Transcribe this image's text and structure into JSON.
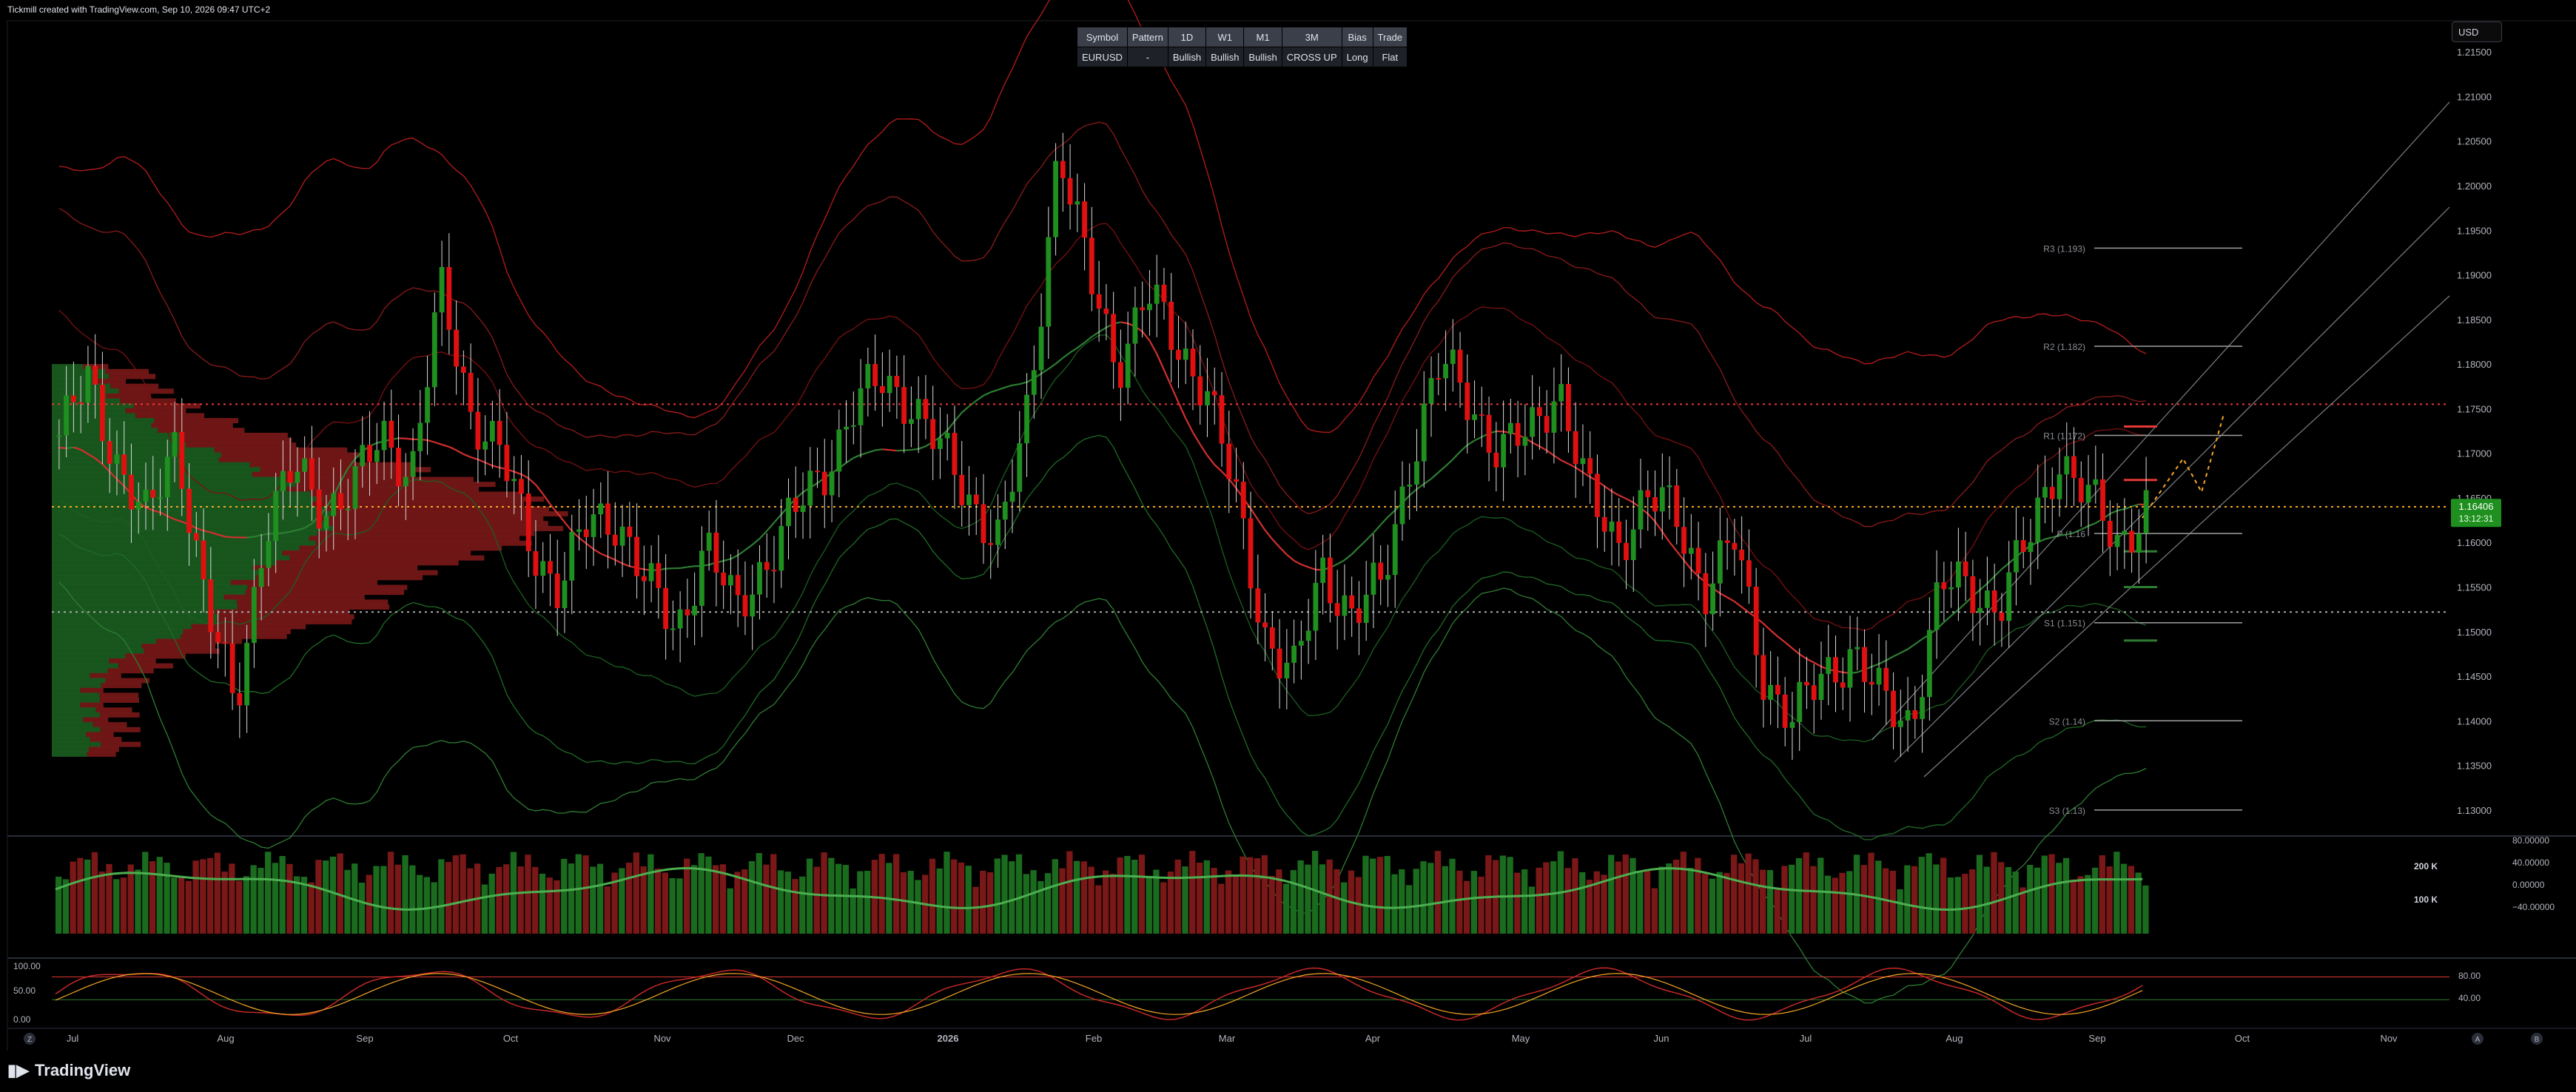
{
  "header": {
    "watermark": "Tickmill created with TradingView.com, Sep 10, 2026 09:47 UTC+2"
  },
  "currency_selector": "USD",
  "signal_table": {
    "headers": [
      "Symbol",
      "Pattern",
      "1D",
      "W1",
      "M1",
      "3M",
      "Bias",
      "Trade"
    ],
    "values": [
      "EURUSD",
      "-",
      "Bullish",
      "Bullish",
      "Bullish",
      "CROSS UP",
      "Long",
      "Flat"
    ]
  },
  "brand": {
    "logo_icon": "tradingview-logo-icon",
    "name": "TradingView"
  },
  "colors": {
    "bull": "#1f8f1f",
    "bear": "#e01010",
    "accent_green": "#21c24a",
    "last_price_bg": "#1f8f1f"
  },
  "chart_data": [
    {
      "type": "candlestick",
      "symbol": "EURUSD",
      "x_labels": [
        "Jul",
        "Aug",
        "Sep",
        "Oct",
        "Nov",
        "Dec",
        "2026",
        "Feb",
        "Mar",
        "Apr",
        "May",
        "Jun",
        "Jul",
        "Aug",
        "Sep",
        "Oct",
        "Nov"
      ],
      "y_ticks": [
        "1.21500",
        "1.21000",
        "1.20500",
        "1.20000",
        "1.19500",
        "1.19000",
        "1.18500",
        "1.18000",
        "1.17500",
        "1.17000",
        "1.16500",
        "1.16000",
        "1.15500",
        "1.15000",
        "1.14500",
        "1.14000",
        "1.13500",
        "1.13000"
      ],
      "ylim": [
        1.1275,
        1.2175
      ],
      "last_price": "1.16406",
      "countdown": "13:12:31",
      "close_path": [
        [
          "Jul",
          1.172
        ],
        [
          "Jul",
          1.178
        ],
        [
          "Jul",
          1.169
        ],
        [
          "Jul",
          1.162
        ],
        [
          "Jul",
          1.172
        ],
        [
          "Aug",
          1.153
        ],
        [
          "Aug",
          1.141
        ],
        [
          "Aug",
          1.162
        ],
        [
          "Aug",
          1.168
        ],
        [
          "Aug",
          1.164
        ],
        [
          "Sep",
          1.166
        ],
        [
          "Sep",
          1.172
        ],
        [
          "Sep",
          1.168
        ],
        [
          "Sep",
          1.188
        ],
        [
          "Sep",
          1.175
        ],
        [
          "Oct",
          1.17
        ],
        [
          "Oct",
          1.16
        ],
        [
          "Oct",
          1.155
        ],
        [
          "Oct",
          1.162
        ],
        [
          "Oct",
          1.163
        ],
        [
          "Nov",
          1.155
        ],
        [
          "Nov",
          1.15
        ],
        [
          "Nov",
          1.16
        ],
        [
          "Nov",
          1.152
        ],
        [
          "Dec",
          1.158
        ],
        [
          "Dec",
          1.163
        ],
        [
          "Dec",
          1.168
        ],
        [
          "Dec",
          1.175
        ],
        [
          "Dec",
          1.178
        ],
        [
          "2026",
          1.176
        ],
        [
          "2026",
          1.17
        ],
        [
          "2026",
          1.165
        ],
        [
          "2026",
          1.16
        ],
        [
          "2026",
          1.175
        ],
        [
          "Feb",
          1.205
        ],
        [
          "Feb",
          1.19
        ],
        [
          "Feb",
          1.18
        ],
        [
          "Feb",
          1.188
        ],
        [
          "Feb",
          1.182
        ],
        [
          "Mar",
          1.178
        ],
        [
          "Mar",
          1.165
        ],
        [
          "Mar",
          1.15
        ],
        [
          "Mar",
          1.145
        ],
        [
          "Mar",
          1.157
        ],
        [
          "Apr",
          1.152
        ],
        [
          "Apr",
          1.155
        ],
        [
          "Apr",
          1.17
        ],
        [
          "Apr",
          1.18
        ],
        [
          "Apr",
          1.176
        ],
        [
          "May",
          1.17
        ],
        [
          "May",
          1.172
        ],
        [
          "May",
          1.178
        ],
        [
          "May",
          1.165
        ],
        [
          "May",
          1.16
        ],
        [
          "Jun",
          1.165
        ],
        [
          "Jun",
          1.163
        ],
        [
          "Jun",
          1.155
        ],
        [
          "Jun",
          1.16
        ],
        [
          "Jul",
          1.145
        ],
        [
          "Jul",
          1.14
        ],
        [
          "Jul",
          1.145
        ],
        [
          "Jul",
          1.148
        ],
        [
          "Jul",
          1.142
        ],
        [
          "Aug",
          1.14
        ],
        [
          "Aug",
          1.155
        ],
        [
          "Aug",
          1.155
        ],
        [
          "Aug",
          1.153
        ],
        [
          "Aug",
          1.16
        ],
        [
          "Sep",
          1.17
        ],
        [
          "Sep",
          1.165
        ],
        [
          "Sep",
          1.16
        ],
        [
          "Sep",
          1.164
        ]
      ],
      "horizontal_lines": [
        {
          "level": 1.1755,
          "style": "dotted",
          "color": "#e53935"
        },
        {
          "level": 1.164,
          "style": "dotted",
          "color": "#f5a623"
        },
        {
          "level": 1.1522,
          "style": "dotted",
          "color": "#aaaaaa"
        }
      ],
      "pivot_levels": [
        {
          "label": "R3 (1.193)",
          "value": 1.193
        },
        {
          "label": "R2 (1.182)",
          "value": 1.182
        },
        {
          "label": "R1 (1.172)",
          "value": 1.172
        },
        {
          "label": "P (1.16",
          "value": 1.161
        },
        {
          "label": "S1 (1.151)",
          "value": 1.151
        },
        {
          "label": "S2 (1.14)",
          "value": 1.14
        },
        {
          "label": "S3 (1.13)",
          "value": 1.13
        }
      ]
    },
    {
      "type": "bar",
      "name": "volume-oscillator-pane",
      "left_ticks": [
        "200 K",
        "100 K"
      ],
      "right_ticks": [
        "80.00000",
        "40.00000",
        "0.00000",
        "−40.00000"
      ],
      "ylim_right": [
        -60,
        100
      ]
    },
    {
      "type": "line",
      "name": "stochastic-pane",
      "left_ticks": [
        "100.00",
        "50.00",
        "0.00"
      ],
      "right_ticks": [
        "80.00",
        "40.00"
      ],
      "ylim": [
        0,
        100
      ]
    }
  ],
  "footer": {
    "left_badge": "Z",
    "right_badges": [
      "A",
      "B"
    ]
  }
}
